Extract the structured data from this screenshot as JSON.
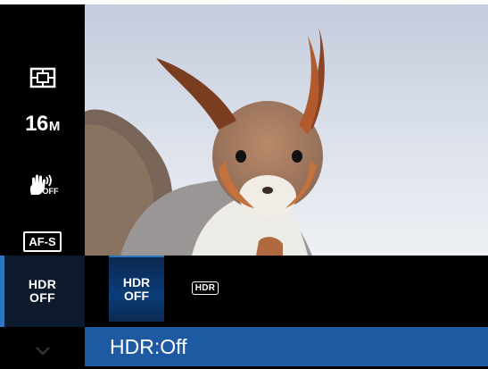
{
  "rail": {
    "items": [
      {
        "name": "metering-icon"
      },
      {
        "resolution_value": "16",
        "resolution_unit": "M"
      },
      {
        "name": "stabilizer-off-icon",
        "off_label": "OFF"
      },
      {
        "focus_label": "AF-S"
      },
      {
        "hdr_line1": "HDR",
        "hdr_line2": "OFF"
      }
    ],
    "scroll_icon": "chevron-down-icon"
  },
  "options": {
    "hdr_off_line1": "HDR",
    "hdr_off_line2": "OFF",
    "hdr_on_badge": "HDR"
  },
  "status": {
    "text": "HDR:Off"
  },
  "colors": {
    "accent": "#2f74c0",
    "status_bar": "#1d5aa1"
  }
}
